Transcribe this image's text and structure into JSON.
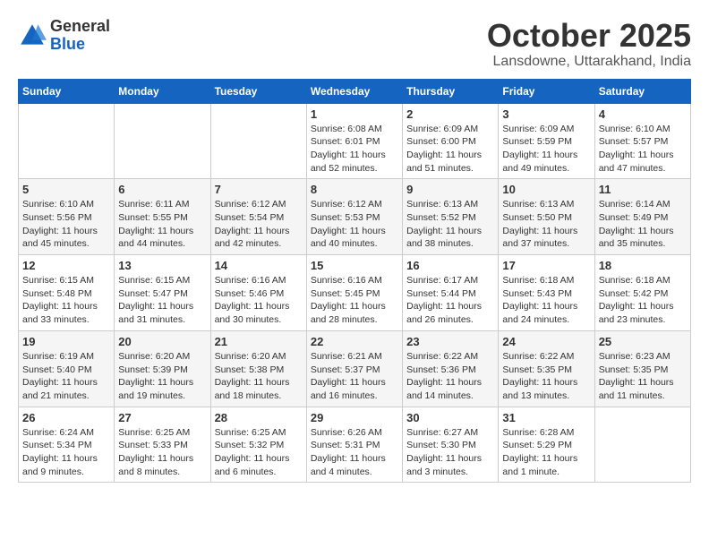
{
  "header": {
    "logo_general": "General",
    "logo_blue": "Blue",
    "month_title": "October 2025",
    "location": "Lansdowne, Uttarakhand, India"
  },
  "weekdays": [
    "Sunday",
    "Monday",
    "Tuesday",
    "Wednesday",
    "Thursday",
    "Friday",
    "Saturday"
  ],
  "weeks": [
    [
      {
        "day": "",
        "info": ""
      },
      {
        "day": "",
        "info": ""
      },
      {
        "day": "",
        "info": ""
      },
      {
        "day": "1",
        "info": "Sunrise: 6:08 AM\nSunset: 6:01 PM\nDaylight: 11 hours and 52 minutes."
      },
      {
        "day": "2",
        "info": "Sunrise: 6:09 AM\nSunset: 6:00 PM\nDaylight: 11 hours and 51 minutes."
      },
      {
        "day": "3",
        "info": "Sunrise: 6:09 AM\nSunset: 5:59 PM\nDaylight: 11 hours and 49 minutes."
      },
      {
        "day": "4",
        "info": "Sunrise: 6:10 AM\nSunset: 5:57 PM\nDaylight: 11 hours and 47 minutes."
      }
    ],
    [
      {
        "day": "5",
        "info": "Sunrise: 6:10 AM\nSunset: 5:56 PM\nDaylight: 11 hours and 45 minutes."
      },
      {
        "day": "6",
        "info": "Sunrise: 6:11 AM\nSunset: 5:55 PM\nDaylight: 11 hours and 44 minutes."
      },
      {
        "day": "7",
        "info": "Sunrise: 6:12 AM\nSunset: 5:54 PM\nDaylight: 11 hours and 42 minutes."
      },
      {
        "day": "8",
        "info": "Sunrise: 6:12 AM\nSunset: 5:53 PM\nDaylight: 11 hours and 40 minutes."
      },
      {
        "day": "9",
        "info": "Sunrise: 6:13 AM\nSunset: 5:52 PM\nDaylight: 11 hours and 38 minutes."
      },
      {
        "day": "10",
        "info": "Sunrise: 6:13 AM\nSunset: 5:50 PM\nDaylight: 11 hours and 37 minutes."
      },
      {
        "day": "11",
        "info": "Sunrise: 6:14 AM\nSunset: 5:49 PM\nDaylight: 11 hours and 35 minutes."
      }
    ],
    [
      {
        "day": "12",
        "info": "Sunrise: 6:15 AM\nSunset: 5:48 PM\nDaylight: 11 hours and 33 minutes."
      },
      {
        "day": "13",
        "info": "Sunrise: 6:15 AM\nSunset: 5:47 PM\nDaylight: 11 hours and 31 minutes."
      },
      {
        "day": "14",
        "info": "Sunrise: 6:16 AM\nSunset: 5:46 PM\nDaylight: 11 hours and 30 minutes."
      },
      {
        "day": "15",
        "info": "Sunrise: 6:16 AM\nSunset: 5:45 PM\nDaylight: 11 hours and 28 minutes."
      },
      {
        "day": "16",
        "info": "Sunrise: 6:17 AM\nSunset: 5:44 PM\nDaylight: 11 hours and 26 minutes."
      },
      {
        "day": "17",
        "info": "Sunrise: 6:18 AM\nSunset: 5:43 PM\nDaylight: 11 hours and 24 minutes."
      },
      {
        "day": "18",
        "info": "Sunrise: 6:18 AM\nSunset: 5:42 PM\nDaylight: 11 hours and 23 minutes."
      }
    ],
    [
      {
        "day": "19",
        "info": "Sunrise: 6:19 AM\nSunset: 5:40 PM\nDaylight: 11 hours and 21 minutes."
      },
      {
        "day": "20",
        "info": "Sunrise: 6:20 AM\nSunset: 5:39 PM\nDaylight: 11 hours and 19 minutes."
      },
      {
        "day": "21",
        "info": "Sunrise: 6:20 AM\nSunset: 5:38 PM\nDaylight: 11 hours and 18 minutes."
      },
      {
        "day": "22",
        "info": "Sunrise: 6:21 AM\nSunset: 5:37 PM\nDaylight: 11 hours and 16 minutes."
      },
      {
        "day": "23",
        "info": "Sunrise: 6:22 AM\nSunset: 5:36 PM\nDaylight: 11 hours and 14 minutes."
      },
      {
        "day": "24",
        "info": "Sunrise: 6:22 AM\nSunset: 5:35 PM\nDaylight: 11 hours and 13 minutes."
      },
      {
        "day": "25",
        "info": "Sunrise: 6:23 AM\nSunset: 5:35 PM\nDaylight: 11 hours and 11 minutes."
      }
    ],
    [
      {
        "day": "26",
        "info": "Sunrise: 6:24 AM\nSunset: 5:34 PM\nDaylight: 11 hours and 9 minutes."
      },
      {
        "day": "27",
        "info": "Sunrise: 6:25 AM\nSunset: 5:33 PM\nDaylight: 11 hours and 8 minutes."
      },
      {
        "day": "28",
        "info": "Sunrise: 6:25 AM\nSunset: 5:32 PM\nDaylight: 11 hours and 6 minutes."
      },
      {
        "day": "29",
        "info": "Sunrise: 6:26 AM\nSunset: 5:31 PM\nDaylight: 11 hours and 4 minutes."
      },
      {
        "day": "30",
        "info": "Sunrise: 6:27 AM\nSunset: 5:30 PM\nDaylight: 11 hours and 3 minutes."
      },
      {
        "day": "31",
        "info": "Sunrise: 6:28 AM\nSunset: 5:29 PM\nDaylight: 11 hours and 1 minute."
      },
      {
        "day": "",
        "info": ""
      }
    ]
  ]
}
